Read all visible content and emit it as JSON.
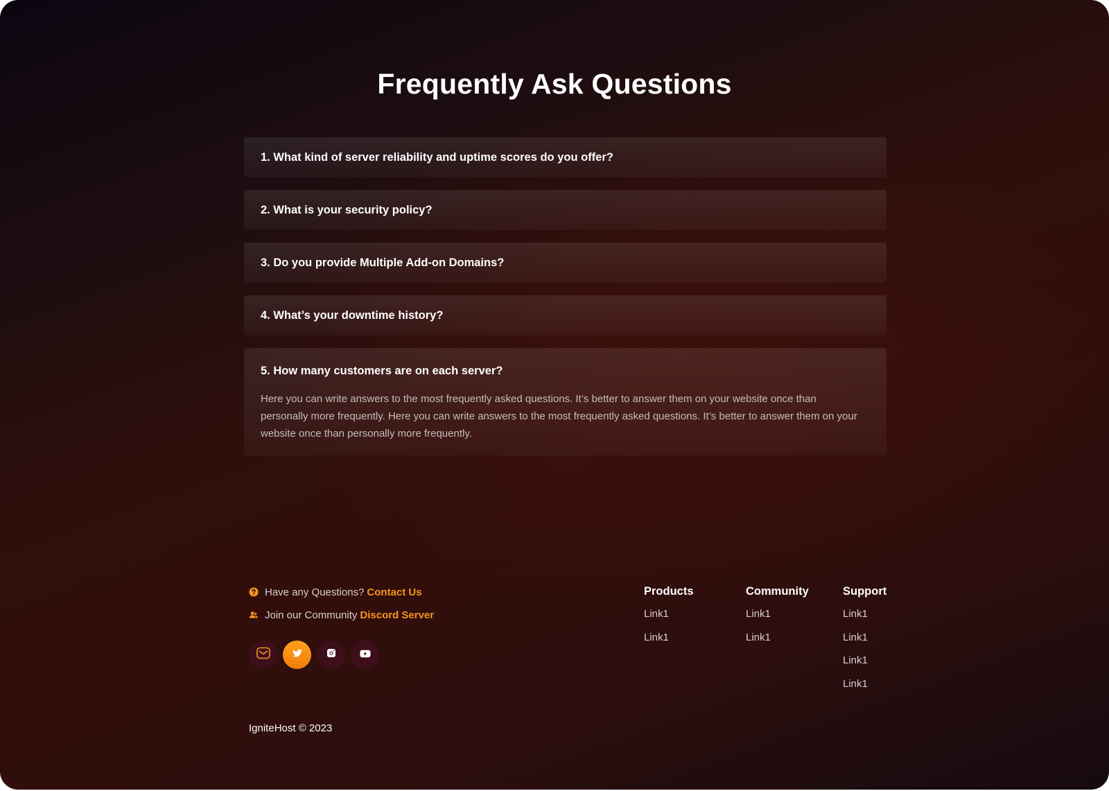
{
  "page": {
    "title": "Frequently Ask Questions"
  },
  "faq": [
    {
      "question": "1. What kind of server reliability and uptime scores do you offer?",
      "open": false
    },
    {
      "question": "2. What is your security policy?",
      "open": false
    },
    {
      "question": "3. Do you provide Multiple Add-on Domains?",
      "open": false
    },
    {
      "question": "4. What’s your downtime history?",
      "open": false
    },
    {
      "question": "5. How many customers are on each server?",
      "open": true,
      "answer": "Here you can write answers to the most frequently asked questions. It’s better to answer them on your website once than personally more frequently. Here you can write answers to the most frequently asked questions. It’s better to answer them on your website once than personally more frequently."
    }
  ],
  "footer": {
    "questions_text": "Have any Questions?",
    "questions_link": "Contact Us",
    "community_text": "Join our Community",
    "community_link": "Discord Server",
    "socials": [
      {
        "icon": "mail-icon",
        "active": false
      },
      {
        "icon": "twitter-icon",
        "active": true
      },
      {
        "icon": "instagram-icon",
        "active": false
      },
      {
        "icon": "youtube-icon",
        "active": false
      }
    ],
    "columns": [
      {
        "title": "Products",
        "links": [
          "Link1",
          "Link1"
        ]
      },
      {
        "title": "Community",
        "links": [
          "Link1",
          "Link1"
        ]
      },
      {
        "title": "Support",
        "links": [
          "Link1",
          "Link1",
          "Link1",
          "Link1"
        ]
      }
    ],
    "copyright": "IgniteHost © 2023"
  },
  "colors": {
    "accent": "#f7941d",
    "social_bg": "#3d0f1a",
    "background_dark": "#0c0611",
    "background_red": "#320e0b"
  }
}
